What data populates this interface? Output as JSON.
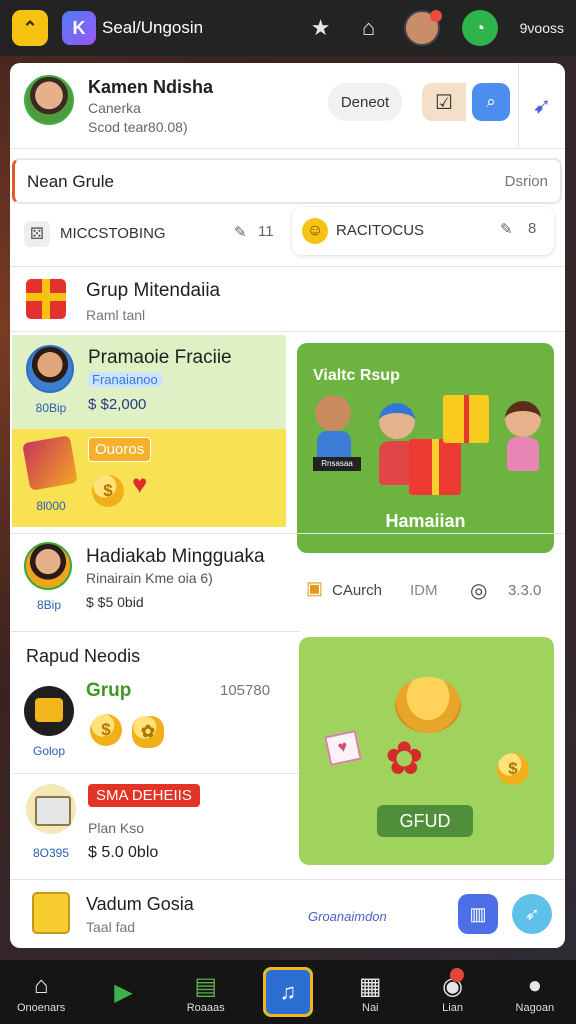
{
  "topbar": {
    "title": "Seal/Ungosin",
    "points": "9νooss",
    "app_icon_letter": "K"
  },
  "profile": {
    "name": "Kamen Ndisha",
    "subtitle": "Canerka",
    "balance": "Scod tear80.08)",
    "deposit_label": "Deneot"
  },
  "search": {
    "label": "Nean Grule",
    "placeholder": "Dsrion"
  },
  "stats": {
    "left_label": "MICCSTOBING",
    "left_value": "11",
    "right_label": "RACITOCUS",
    "right_value": "8"
  },
  "group_section": {
    "title": "Grup Mitendaiia",
    "subtitle": "Raml tanl"
  },
  "promo": {
    "title": "Pramaoie Fraciie",
    "badge": "Franaianoo",
    "price": "$ $2,000",
    "avatar_caption": "80Bip",
    "yellow_badge": "Ouoros",
    "yellow_caption": "8l000"
  },
  "green_card": {
    "title": "Vialtc Rsup",
    "footer": "Hamaiian",
    "sign_text": "Rnsasaa"
  },
  "weekly": {
    "title": "Hadiakab Mingguaka",
    "subtitle": "Rinairain Kme oia 6)",
    "price": "$ $5 0bid",
    "avatar_caption": "8Bip",
    "row_label": "CAurch",
    "row_mid": "IDM",
    "row_value": "3.3.0"
  },
  "rapid": {
    "title": "Rapud Neodis",
    "grup_label": "Grup",
    "count": "105780",
    "avatar_caption": "Golop"
  },
  "pack": {
    "badge": "SMA DEHEIIS",
    "subtitle": "Plan Kso",
    "price": "$ 5.0 0blo",
    "caption": "8O395"
  },
  "green_card2": {
    "button_label": "GFUD"
  },
  "bottom_row": {
    "title": "Vadum Gosia",
    "subtitle": "Taal fad",
    "mid_text": "Groanaimdon"
  },
  "bottom_nav": {
    "items": [
      {
        "label": "Onoenars"
      },
      {
        "label": ""
      },
      {
        "label": "Roaaas"
      },
      {
        "label": ""
      },
      {
        "label": "Nai"
      },
      {
        "label": "Lian"
      },
      {
        "label": "Nagoan"
      }
    ]
  }
}
